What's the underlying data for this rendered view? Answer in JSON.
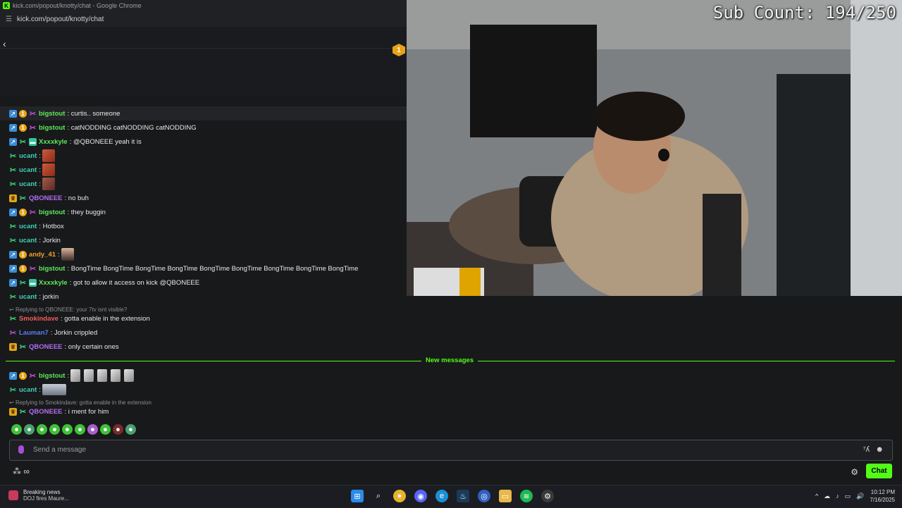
{
  "browser": {
    "title": "kick.com/popout/knotty/chat - Google Chrome",
    "url": "kick.com/popout/knotty/chat"
  },
  "chat_header": {
    "badge_count": "1"
  },
  "stream": {
    "sub_count": "Sub Count: 194/250"
  },
  "messages": [
    {
      "user": "bigstout",
      "text": "curtis.. someone"
    },
    {
      "user": "bigstout",
      "text": "catNODDING catNODDING catNODDING"
    },
    {
      "user": "Xxxxkyle",
      "text": "@QBONEEE yeah it is"
    },
    {
      "user": "ucant",
      "text": ""
    },
    {
      "user": "ucant",
      "text": ""
    },
    {
      "user": "ucant",
      "text": ""
    },
    {
      "user": "QBONEEE",
      "text": "no buh"
    },
    {
      "user": "bigstout",
      "text": "they buggin"
    },
    {
      "user": "ucant",
      "text": "Hotbox"
    },
    {
      "user": "ucant",
      "text": "Jorkin"
    },
    {
      "user": "andy_41",
      "text": ""
    },
    {
      "user": "bigstout",
      "text": "BongTime BongTime BongTime BongTime BongTime BongTime BongTime BongTime BongTime"
    },
    {
      "user": "Xxxxkyle",
      "text": "got to allow it access on kick @QBONEEE"
    },
    {
      "user": "ucant",
      "text": "jorkin"
    },
    {
      "reply": "Replying to QBONEEE: your 7tv isnt visible?"
    },
    {
      "user": "Smokindave",
      "text": "gotta enable in the extension"
    },
    {
      "user": "Lauman7",
      "text": "Jorkin crippled"
    },
    {
      "user": "QBONEEE",
      "text": "only certain ones"
    },
    {
      "user": "bigstout",
      "text": ""
    },
    {
      "user": "ucant",
      "text": ""
    },
    {
      "reply": "Replying to Smokindave: gotta enable in the extension"
    },
    {
      "user": "QBONEEE",
      "text": "i ment for him"
    }
  ],
  "new_messages_label": "New messages",
  "input": {
    "placeholder": "Send a message"
  },
  "chat_button": "Chat",
  "taskbar": {
    "news_title": "Breaking news",
    "news_sub": "DOJ fires Maure...",
    "time": "10:12 PM",
    "date": "7/16/2025"
  },
  "colors": {
    "kick_green": "#53fc18",
    "accent_purple": "#a44fd6"
  }
}
